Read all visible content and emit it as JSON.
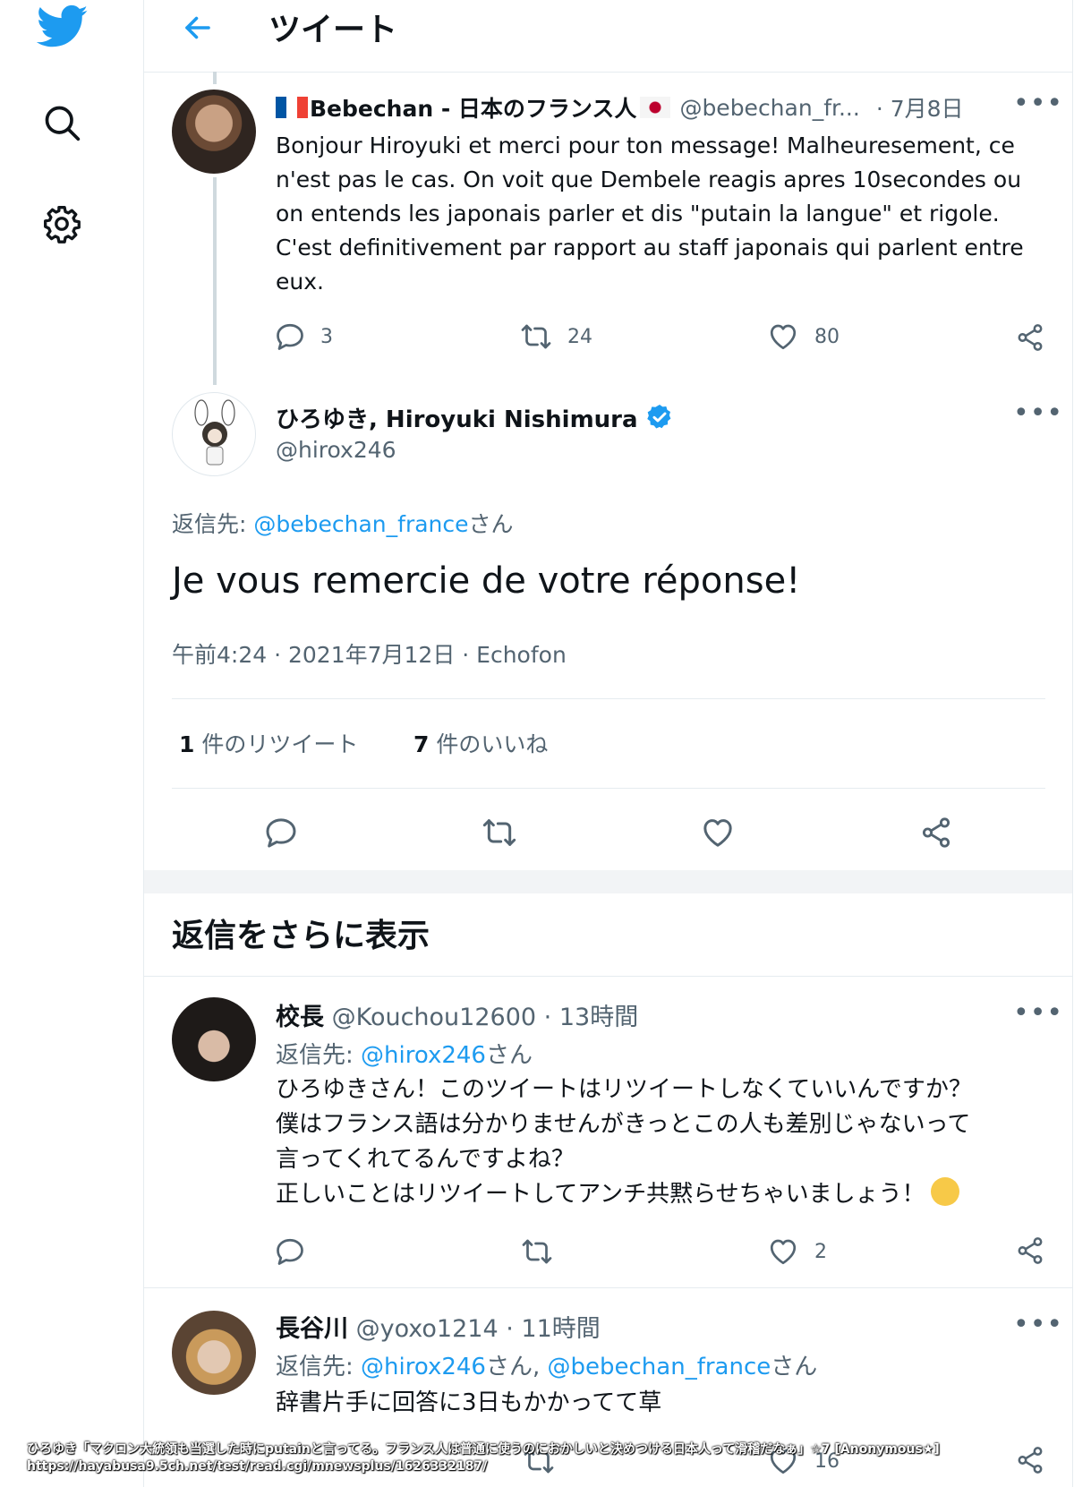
{
  "header": {
    "title": "ツイート"
  },
  "tweet1": {
    "name": "Bebechan - 日本のフランス人",
    "handle": "@bebechan_fr...",
    "time": "· 7月8日",
    "text": "Bonjour Hiroyuki et merci pour ton message! Malheuresement, ce n'est pas le cas. On voit que Dembele reagis apres 10secondes ou on entends les japonais parler et dis \"putain la langue\" et rigole. C'est definitivement par rapport au staff japonais qui parlent entre eux.",
    "replies": "3",
    "retweets": "24",
    "likes": "80"
  },
  "main": {
    "name": "ひろゆき, Hiroyuki Nishimura",
    "handle": "@hirox246",
    "reply_to_label": "返信先:",
    "reply_to_handle": "@bebechan_france",
    "reply_to_suffix": "さん",
    "text": "Je vous remercie de votre réponse!",
    "meta": "午前4:24 · 2021年7月12日 · Echofon",
    "retweet_count": "1",
    "retweet_label": "件のリツイート",
    "like_count": "7",
    "like_label": "件のいいね"
  },
  "more_replies": "返信をさらに表示",
  "reply1": {
    "name": "校長",
    "handle": "@Kouchou12600",
    "time": "· 13時間",
    "reply_to_label": "返信先:",
    "reply_to_handle": "@hirox246",
    "reply_to_suffix": "さん",
    "line1": "ひろゆきさん！このツイートはリツイートしなくていいんですか？",
    "line2": "僕はフランス語は分かりませんがきっとこの人も差別じゃないって",
    "line3": "言ってくれてるんですよね？",
    "line4": "正しいことはリツイートしてアンチ共黙らせちゃいましょう！",
    "likes": "2"
  },
  "reply2": {
    "name": "長谷川",
    "handle": "@yoxo1214",
    "time": "· 11時間",
    "reply_to_label": "返信先:",
    "reply_to_handle1": "@hirox246",
    "reply_to_mid": "さん, ",
    "reply_to_handle2": "@bebechan_france",
    "reply_to_suffix": "さん",
    "text": "辞書片手に回答に3日もかかってて草",
    "likes": "16"
  },
  "watermark": {
    "line1": "ひろゆき「マクロン大統領も当選した時にputainと言ってる。フランス人は普通に使うのにおかしいと決めつける日本人って滑稽だなぁ」☆7 [Anonymous★]",
    "line2": "https://hayabusa9.5ch.net/test/read.cgi/mnewsplus/1626332187/"
  },
  "colors": {
    "accent": "#1d9bf0",
    "muted": "#536471",
    "text": "#0f1419"
  }
}
